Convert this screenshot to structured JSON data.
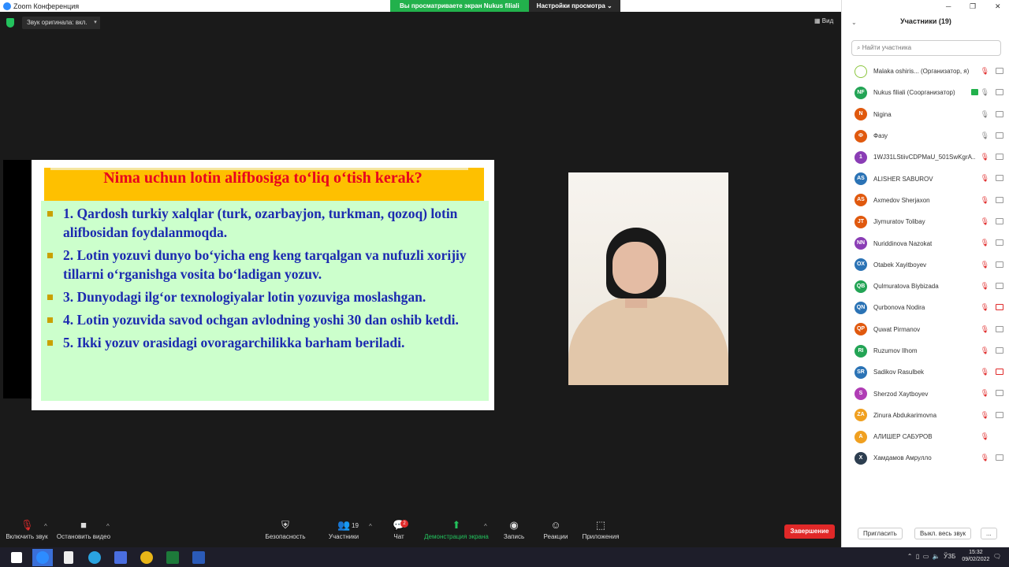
{
  "window": {
    "title": "Zoom Конференция"
  },
  "banner": {
    "sharing": "Вы просматриваете экран Nukus filiali",
    "view_options": "Настройки просмотра"
  },
  "top": {
    "audio": "Звук оригинала: вкл.",
    "view": "Вид"
  },
  "slide": {
    "title": "Nima uchun lotin alifbosiga to‘liq o‘tish kerak?",
    "items": [
      "1. Qardosh turkiy xalqlar (turk, ozarbayjon, turkman, qozoq) lotin alifbosidan foydalanmoqda.",
      "2. Lotin yozuvi dunyo bo‘yicha eng keng tarqalgan va nufuzli xorijiy tillarni o‘rganishga vosita bo‘ladigan yozuv.",
      "3. Dunyodagi ilg‘or texnologiyalar lotin yozuviga moslashgan.",
      "4. Lotin yozuvida savod ochgan avlodning yoshi 30 dan oshib ketdi.",
      "5. Ikki yozuv orasidagi ovoragarchilikka barham beriladi."
    ]
  },
  "controls": {
    "mute": "Включить звук",
    "video": "Остановить видео",
    "security": "Безопасность",
    "participants": "Участники",
    "participants_count": "19",
    "chat": "Чат",
    "chat_badge": "2",
    "share": "Демонстрация экрана",
    "record": "Запись",
    "reactions": "Реакции",
    "apps": "Приложения",
    "end": "Завершение"
  },
  "panel": {
    "title": "Участники (19)",
    "search_placeholder": "Найти участника",
    "participants": [
      {
        "initials": "",
        "name": "Malaka oshiris... (Организатор, я)",
        "color": "#ffffff"
      },
      {
        "initials": "NF",
        "name": "Nukus filiali (Соорганизатор)",
        "color": "#23a455"
      },
      {
        "initials": "N",
        "name": "Nigina",
        "color": "#e0590e"
      },
      {
        "initials": "Ф",
        "name": "Фазу",
        "color": "#e0590e"
      },
      {
        "initials": "1",
        "name": "1WJ31LStiivCDPMaU_501SwKgrA...",
        "color": "#8a3db5"
      },
      {
        "initials": "AS",
        "name": "ALISHER SABUROV",
        "color": "#2b73b5"
      },
      {
        "initials": "AS",
        "name": "Axmedov Sherjaxon",
        "color": "#e0590e"
      },
      {
        "initials": "JT",
        "name": "Jiymuratov Tolibay",
        "color": "#e0590e"
      },
      {
        "initials": "NN",
        "name": "Nuriddinova Nazokat",
        "color": "#8a3db5"
      },
      {
        "initials": "OX",
        "name": "Otabek Xayitboyev",
        "color": "#2b73b5"
      },
      {
        "initials": "QB",
        "name": "Qulmuratova Biybizada",
        "color": "#23a455"
      },
      {
        "initials": "QN",
        "name": "Qurbonova Nodira",
        "color": "#2b73b5"
      },
      {
        "initials": "QP",
        "name": "Quwat Pirmanov",
        "color": "#e0590e"
      },
      {
        "initials": "RI",
        "name": "Ruzumov Ilhom",
        "color": "#23a455"
      },
      {
        "initials": "SR",
        "name": "Sadikov Rasulbek",
        "color": "#2b73b5"
      },
      {
        "initials": "S",
        "name": "Sherzod Xaytboyev",
        "color": "#b03db5"
      },
      {
        "initials": "ZA",
        "name": "Zinura Abdukarimovna",
        "color": "#f0a020"
      },
      {
        "initials": "A",
        "name": "АЛИШЕР САБУРОВ",
        "color": "#f0a020"
      },
      {
        "initials": "X",
        "name": "Хамдамов Амрулло",
        "color": "#2d3e50"
      }
    ],
    "invite": "Пригласить",
    "mute_all": "Выкл. весь звук",
    "more": "..."
  },
  "taskbar": {
    "lang": "ЎЗБ",
    "time": "15:32",
    "date": "09/02/2022"
  }
}
